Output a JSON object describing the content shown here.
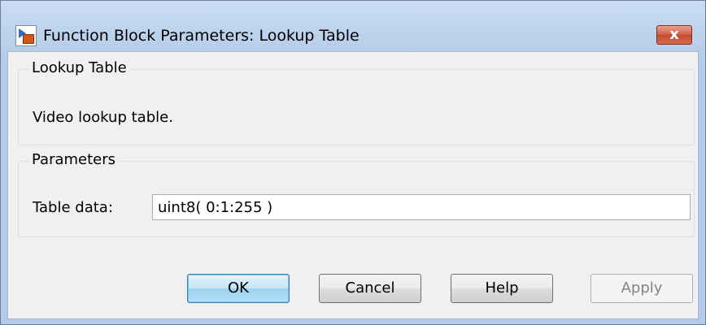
{
  "window": {
    "title": "Function Block Parameters: Lookup Table",
    "app_icon": "simulink-block-icon",
    "close_label": "x"
  },
  "block_group": {
    "legend": "Lookup Table",
    "description": "Video lookup table."
  },
  "parameters_group": {
    "legend": "Parameters",
    "table_data_label": "Table data:",
    "table_data_value": "uint8( 0:1:255 )"
  },
  "buttons": {
    "ok": "OK",
    "cancel": "Cancel",
    "help": "Help",
    "apply": "Apply"
  },
  "colors": {
    "default_button_border": "#3c7fb1",
    "close_button": "#c44a30",
    "disabled_text": "#838383"
  }
}
